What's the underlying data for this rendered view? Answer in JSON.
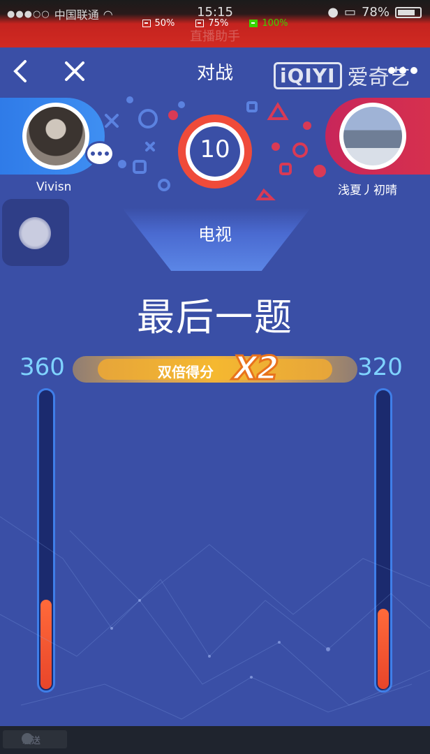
{
  "status_bar": {
    "carrier": "中国联通",
    "time": "15:15",
    "battery": "78%",
    "zoom_options": [
      "50%",
      "75%",
      "100%"
    ]
  },
  "faded_title": "直播助手",
  "nav": {
    "title": "对战",
    "watermark_logo": "iQIYI",
    "watermark_name": "爱奇艺"
  },
  "players": {
    "left": {
      "name": "Vivisn",
      "score": "360",
      "progress": 0.3
    },
    "right": {
      "name": "浅夏丿初晴",
      "score": "320",
      "progress": 0.27
    }
  },
  "timer": "10",
  "category": "电视",
  "question_title": "最后一题",
  "bonus": {
    "label": "双倍得分",
    "multiplier": "X2"
  },
  "bottom": {
    "send_label": "发送"
  },
  "colors": {
    "background": "#3a4fa6",
    "left_player": "#3f8ff2",
    "right_player": "#d6304e",
    "timer_ring": "#ef4b3a",
    "score_text": "#7fd3ff",
    "bonus": "#f5b830",
    "bar_fill": "#ff6a3a"
  }
}
